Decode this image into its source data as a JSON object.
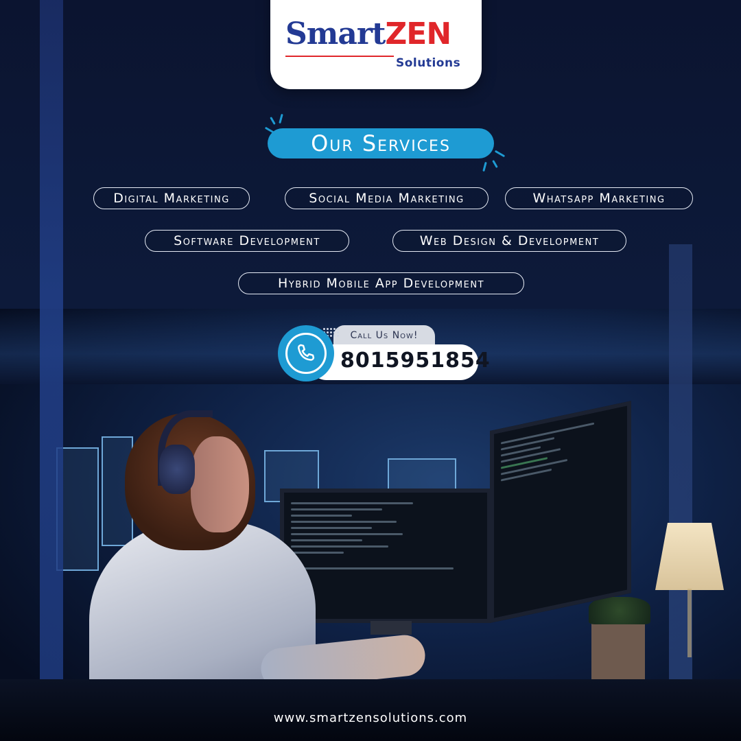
{
  "brand": {
    "name_part1": "Smart",
    "name_part2": "ZEN",
    "subtitle": "Solutions",
    "colors": {
      "primary_blue": "#233a94",
      "accent_red": "#e0262a",
      "accent_cyan": "#1e9bd3"
    }
  },
  "section_title": "Our Services",
  "services": [
    "Digital Marketing",
    "Social Media Marketing",
    "Whatsapp Marketing",
    "Software Development",
    "Web Design & Development",
    "Hybrid Mobile App Development"
  ],
  "call": {
    "label": "Call Us Now!",
    "phone": "8015951854",
    "icon": "phone-icon"
  },
  "website": "www.smartzensolutions.com"
}
